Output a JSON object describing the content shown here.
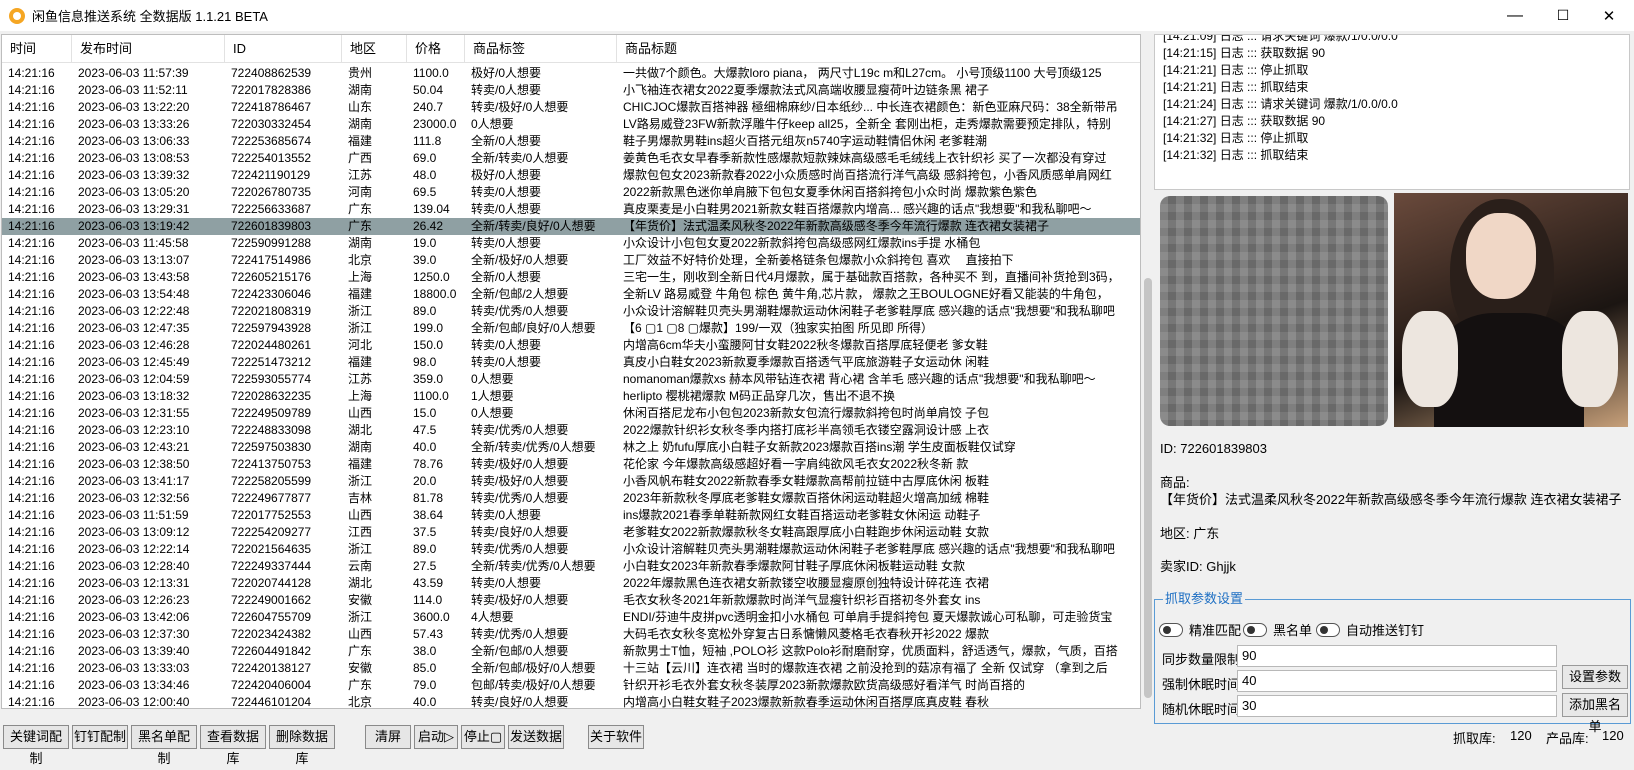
{
  "window": {
    "title": "闲鱼信息推送系统 全数据版 1.1.21 BETA",
    "min": "—",
    "max": "☐",
    "close": "✕"
  },
  "table": {
    "headers": [
      "时间",
      "发布时间",
      "ID",
      "地区",
      "价格",
      "商品标签",
      "商品标题"
    ],
    "rows": [
      [
        "14:21:16",
        "2023-06-03 11:57:39",
        "722408862539",
        "贵州",
        "1100.0",
        "极好/0人想要",
        "一共做7个颜色。大爆款loro piana， 两尺寸L19c m和L27cm。 小号顶级1100 大号顶级125"
      ],
      [
        "14:21:16",
        "2023-06-03 11:52:11",
        "722017828386",
        "湖南",
        "50.04",
        "转卖/0人想要",
        "小飞袖连衣裙女2022夏季爆款法式风高端收腰显瘦荷叶边链条黑 裙子"
      ],
      [
        "14:21:16",
        "2023-06-03 13:22:20",
        "722418786467",
        "山东",
        "240.7",
        "转卖/极好/0人想要",
        "CHICJOC爆款百搭神器 極细棉麻纱/日本纸纱... 中长连衣裙颜色：新色亚麻尺码：38全新带吊"
      ],
      [
        "14:21:16",
        "2023-06-03 13:33:26",
        "722030332454",
        "湖南",
        "23000.0",
        "0人想要",
        "LV路易威登23FW新款浮雕牛仔keep all25，全新全 套刚出柜，走秀爆款需要预定排队，特别"
      ],
      [
        "14:21:16",
        "2023-06-03 13:06:33",
        "722253685674",
        "福建",
        "111.8",
        "全新/0人想要",
        "鞋子男爆款男鞋ins超火百搭元组灰n5740字运动鞋情侣休闲 老爹鞋潮"
      ],
      [
        "14:21:16",
        "2023-06-03 13:08:53",
        "722254013552",
        "广西",
        "69.0",
        "全新/转卖/0人想要",
        "姜黄色毛衣女早春季新款性感爆款短款辣妹高级感毛毛绒线上衣针织衫 买了一次都没有穿过"
      ],
      [
        "14:21:16",
        "2023-06-03 13:39:32",
        "722421190129",
        "江苏",
        "48.0",
        "极好/0人想要",
        "爆款包包女2023新款春2022小众质感时尚百搭流行洋气高级 感斜挎包，小香风质感单肩网红"
      ],
      [
        "14:21:16",
        "2023-06-03 13:05:20",
        "722026780735",
        "河南",
        "69.5",
        "转卖/0人想要",
        "2022新款黑色迷你单肩腋下包包女夏季休闲百搭斜挎包小众时尚 爆款紫色紫色"
      ],
      [
        "14:21:16",
        "2023-06-03 13:29:31",
        "722256633687",
        "广东",
        "139.04",
        "转卖/0人想要",
        "真皮栗麦是小白鞋男2021新款女鞋百搭爆款内增高... 感兴趣的话点\"我想要\"和我私聊吧～"
      ],
      [
        "14:21:16",
        "2023-06-03 13:19:42",
        "722601839803",
        "广东",
        "26.42",
        "全新/转卖/良好/0人想要",
        "【年货价】法式温柔风秋冬2022年新款高级感冬季今年流行爆款 连衣裙女装裙子"
      ],
      [
        "14:21:16",
        "2023-06-03 11:45:58",
        "722590991288",
        "湖南",
        "19.0",
        "转卖/0人想要",
        "小众设计小包包女夏2022新款斜挎包高级感网红爆款ins手提 水桶包"
      ],
      [
        "14:21:16",
        "2023-06-03 13:13:07",
        "722417514986",
        "北京",
        "39.0",
        "全新/极好/0人想要",
        "工厂效益不好特价处理，全新姜格链条包爆款小众斜挎包 喜欢　 直接拍下"
      ],
      [
        "14:21:16",
        "2023-06-03 13:43:58",
        "722605215176",
        "上海",
        "1250.0",
        "全新/0人想要",
        "三宅一生，刚收到全新日代4月爆款，属于基础款百搭款，各种买不 到，直播间补货抢到3码，"
      ],
      [
        "14:21:16",
        "2023-06-03 13:54:48",
        "722423306046",
        "福建",
        "18800.0",
        "全新/包邮/2人想要",
        "全新LV 路易威登 牛角包 棕色 黄牛角,芯片款， 爆款之王BOULOGNE好看又能装的牛角包，"
      ],
      [
        "14:21:16",
        "2023-06-03 12:22:48",
        "722021808319",
        "浙江",
        "89.0",
        "转卖/优秀/0人想要",
        "小众设计溶解鞋贝壳头男潮鞋爆款运动休闲鞋子老爹鞋厚底 感兴趣的话点\"我想要\"和我私聊吧"
      ],
      [
        "14:21:16",
        "2023-06-03 12:47:35",
        "722597943928",
        "浙江",
        "199.0",
        "全新/包邮/良好/0人想要",
        "【6 ▢1 ▢8 ▢爆款】199/一双（独家实拍图 所见即 所得）"
      ],
      [
        "14:21:16",
        "2023-06-03 12:46:28",
        "722024480261",
        "河北",
        "150.0",
        "转卖/0人想要",
        "内增高6cm华夫小蛮腰阿甘女鞋2022秋冬爆款百搭厚底轻便老 爹女鞋"
      ],
      [
        "14:21:16",
        "2023-06-03 12:45:49",
        "722251473212",
        "福建",
        "98.0",
        "转卖/0人想要",
        "真皮小白鞋女2023新款夏季爆款百搭透气平底旅游鞋子女运动休 闲鞋"
      ],
      [
        "14:21:16",
        "2023-06-03 12:04:59",
        "722593055774",
        "江苏",
        "359.0",
        "0人想要",
        "nomanoman爆款xs 赫本风带钻连衣裙 背心裙 含羊毛 感兴趣的话点\"我想要\"和我私聊吧～"
      ],
      [
        "14:21:16",
        "2023-06-03 13:18:32",
        "722028632235",
        "上海",
        "1100.0",
        "1人想要",
        "herlipto 樱桃裙爆款 M码正品穿几次，售出不退不换"
      ],
      [
        "14:21:16",
        "2023-06-03 12:31:55",
        "722249509789",
        "山西",
        "15.0",
        "0人想要",
        "休闲百搭尼龙布小包包2023新款女包流行爆款斜挎包时尚单肩饺 子包"
      ],
      [
        "14:21:16",
        "2023-06-03 12:23:10",
        "722248833098",
        "湖北",
        "47.5",
        "转卖/优秀/0人想要",
        "2022爆款针织衫女秋冬季内搭打底衫半高领毛衣镂空露洞设计感 上衣"
      ],
      [
        "14:21:16",
        "2023-06-03 12:43:21",
        "722597503830",
        "湖南",
        "40.0",
        "全新/转卖/优秀/0人想要",
        "林之上 奶fufu厚底小白鞋子女新款2023爆款百搭ins潮 学生皮面板鞋仅试穿"
      ],
      [
        "14:21:16",
        "2023-06-03 12:38:50",
        "722413750753",
        "福建",
        "78.76",
        "转卖/极好/0人想要",
        "花伦家 今年爆款高级感超好看一字肩纯欲风毛衣女2022秋冬新 款"
      ],
      [
        "14:21:16",
        "2023-06-03 13:41:17",
        "722258205599",
        "浙江",
        "20.0",
        "转卖/极好/0人想要",
        "小香风帆布鞋女2022新款春季女鞋爆款高帮前拉链中古厚底休闲 板鞋"
      ],
      [
        "14:21:16",
        "2023-06-03 12:32:56",
        "722249677877",
        "吉林",
        "81.78",
        "转卖/优秀/0人想要",
        "2023年新款秋冬厚底老爹鞋女爆款百搭休闲运动鞋超火增高加绒 棉鞋"
      ],
      [
        "14:21:16",
        "2023-06-03 11:51:59",
        "722017752553",
        "山西",
        "38.64",
        "转卖/0人想要",
        "ins爆款2021春季单鞋新款网红女鞋百搭运动老爹鞋女休闲运 动鞋子"
      ],
      [
        "14:21:16",
        "2023-06-03 13:09:12",
        "722254209277",
        "江西",
        "37.5",
        "转卖/良好/0人想要",
        "老爹鞋女2022新款爆款秋冬女鞋高跟厚底小白鞋跑步休闲运动鞋 女款"
      ],
      [
        "14:21:16",
        "2023-06-03 12:22:14",
        "722021564635",
        "浙江",
        "89.0",
        "转卖/优秀/0人想要",
        "小众设计溶解鞋贝壳头男潮鞋爆款运动休闲鞋子老爹鞋厚底 感兴趣的话点\"我想要\"和我私聊吧"
      ],
      [
        "14:21:16",
        "2023-06-03 12:28:40",
        "722249337444",
        "云南",
        "27.5",
        "全新/转卖/优秀/0人想要",
        "小白鞋女2023年新款春季爆款阿甘鞋子厚底休闲板鞋运动鞋 女款"
      ],
      [
        "14:21:16",
        "2023-06-03 12:13:31",
        "722020744128",
        "湖北",
        "43.59",
        "转卖/0人想要",
        "2022年爆款黑色连衣裙女新款镂空收腰显瘦原创独特设计碎花连 衣裙"
      ],
      [
        "14:21:16",
        "2023-06-03 12:26:23",
        "722249001662",
        "安徽",
        "114.0",
        "转卖/极好/0人想要",
        "毛衣女秋冬2021年新款爆款时尚洋气显瘦针织衫百搭初冬外套女 ins"
      ],
      [
        "14:21:16",
        "2023-06-03 13:42:06",
        "722604755709",
        "浙江",
        "3600.0",
        "4人想要",
        "ENDI/芬迪牛皮拼pvc透明金扣小水桶包 可单肩手提斜挎包 夏天爆款诚心可私聊，可走验货宝"
      ],
      [
        "14:21:16",
        "2023-06-03 12:37:30",
        "722023424382",
        "山西",
        "57.43",
        "转卖/优秀/0人想要",
        "大码毛衣女秋冬宽松外穿复古日系慵懒风菱格毛衣春秋开衫2022 爆款"
      ],
      [
        "14:21:16",
        "2023-06-03 13:39:40",
        "722604491842",
        "广东",
        "38.0",
        "全新/包邮/0人想要",
        "新款男士T恤，短袖 ,POLO衫 这款Polo衫耐磨耐穿，优质面料，舒适透气，爆款，气质，百搭"
      ],
      [
        "14:21:16",
        "2023-06-03 13:33:03",
        "722420138127",
        "安徽",
        "85.0",
        "全新/包邮/极好/0人想要",
        "十三站【云川】连衣裙 当时的爆款连衣裙 之前没抢到的菇凉有福了 全新 仅试穿 （拿到之后"
      ],
      [
        "14:21:16",
        "2023-06-03 13:34:46",
        "722420406004",
        "广东",
        "79.0",
        "包邮/转卖/极好/0人想要",
        "针织开衫毛衣外套女秋冬装厚2023新款爆款欧货高级感好看洋气 时尚百搭的"
      ],
      [
        "14:21:16",
        "2023-06-03 12:00:40",
        "722446101204",
        "北京",
        "40.0",
        "转卖/良好/0人想要",
        "内增高小白鞋女鞋子2023爆款新款春季运动休闲百搭厚底真皮鞋 春秋"
      ]
    ]
  },
  "log": {
    "lines": [
      "[14:21:09] 日志 ::: 请求关键词 爆款/1/0.0/0.0",
      "[14:21:15] 日志 ::: 获取数据 90",
      "[14:21:21] 日志 ::: 停止抓取",
      "[14:21:21] 日志 ::: 抓取结束",
      "[14:21:24] 日志 ::: 请求关键词 爆款/1/0.0/0.0",
      "[14:21:27] 日志 ::: 获取数据 90",
      "[14:21:32] 日志 ::: 停止抓取",
      "[14:21:32] 日志 ::: 抓取结束"
    ]
  },
  "detail": {
    "id_line": "ID: 722601839803",
    "goods_label": "商品:",
    "goods_title": "【年货价】法式温柔风秋冬2022年新款高级感冬季今年流行爆款 连衣裙女装裙子",
    "region_line": "地区: 广东",
    "seller_line": "卖家ID: Ghjjk"
  },
  "params": {
    "legend": "抓取参数设置",
    "toggles": [
      "精准匹配",
      "黑名单",
      "自动推送钉钉"
    ],
    "sync_label": "同步数量限制",
    "sync_value": "90",
    "sleep_label": "强制休眠时间",
    "sleep_value": "40",
    "rand_label": "随机休眠时间",
    "rand_value": "30",
    "set_button": "设置参数",
    "blacklist_button": "添加黑名单"
  },
  "toolbar": {
    "keyword_config": "关键词配制",
    "dingtalk_config": "钉钉配制",
    "blacklist_config": "黑名单配制",
    "view_db": "查看数据库",
    "delete_db": "删除数据库",
    "clear_screen": "清屏",
    "start": "启动▷",
    "stop": "停止▢",
    "send_data": "发送数据",
    "about": "关于软件"
  },
  "status": {
    "fetch_label": "抓取库:",
    "fetch_value": "120",
    "product_label": "产品库:",
    "product_value": "120"
  },
  "selected_row_index": 9
}
